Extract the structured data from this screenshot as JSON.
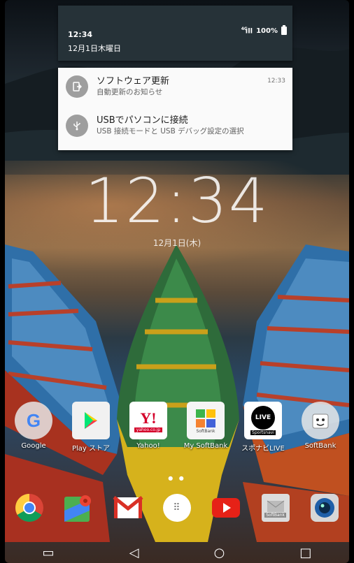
{
  "status_bar": {
    "time": "12:34",
    "date": "12月1日木曜日",
    "network": "4G",
    "battery": "100%"
  },
  "notifications": [
    {
      "title": "ソフトウェア更新",
      "text": "自動更新のお知らせ",
      "time": "12:33",
      "icon": "system-update-icon"
    },
    {
      "title": "USBでパソコンに接続",
      "text": "USB 接続モードと USB デバッグ設定の選択",
      "time": "",
      "icon": "usb-icon"
    }
  ],
  "lockscreen": {
    "clock": "12:34",
    "date": "12月1日(木)"
  },
  "apps": [
    {
      "label": "Google",
      "icon": "google-folder-icon"
    },
    {
      "label": "Play ストア",
      "icon": "play-store-icon"
    },
    {
      "label": "Yahoo!",
      "icon": "yahoo-icon",
      "badge": "yahoo.co.jp"
    },
    {
      "label": "My SoftBank",
      "icon": "my-softbank-icon",
      "badge": "SoftBank"
    },
    {
      "label": "スポナビLIVE",
      "icon": "sponavi-live-icon",
      "badge_top": "LIVE",
      "badge": "Sportsnavi"
    },
    {
      "label": "SoftBank",
      "icon": "softbank-folder-icon"
    }
  ],
  "dock": [
    {
      "icon": "chrome-icon"
    },
    {
      "icon": "maps-icon"
    },
    {
      "icon": "gmail-icon"
    },
    {
      "icon": "app-drawer-icon"
    },
    {
      "icon": "youtube-icon"
    },
    {
      "icon": "softbank-mail-icon",
      "badge": "SoftBank"
    },
    {
      "icon": "camera-icon"
    }
  ],
  "colors": {
    "shade": "#263238",
    "card": "#fafafa",
    "notif_icon_bg": "#9e9e9e"
  }
}
